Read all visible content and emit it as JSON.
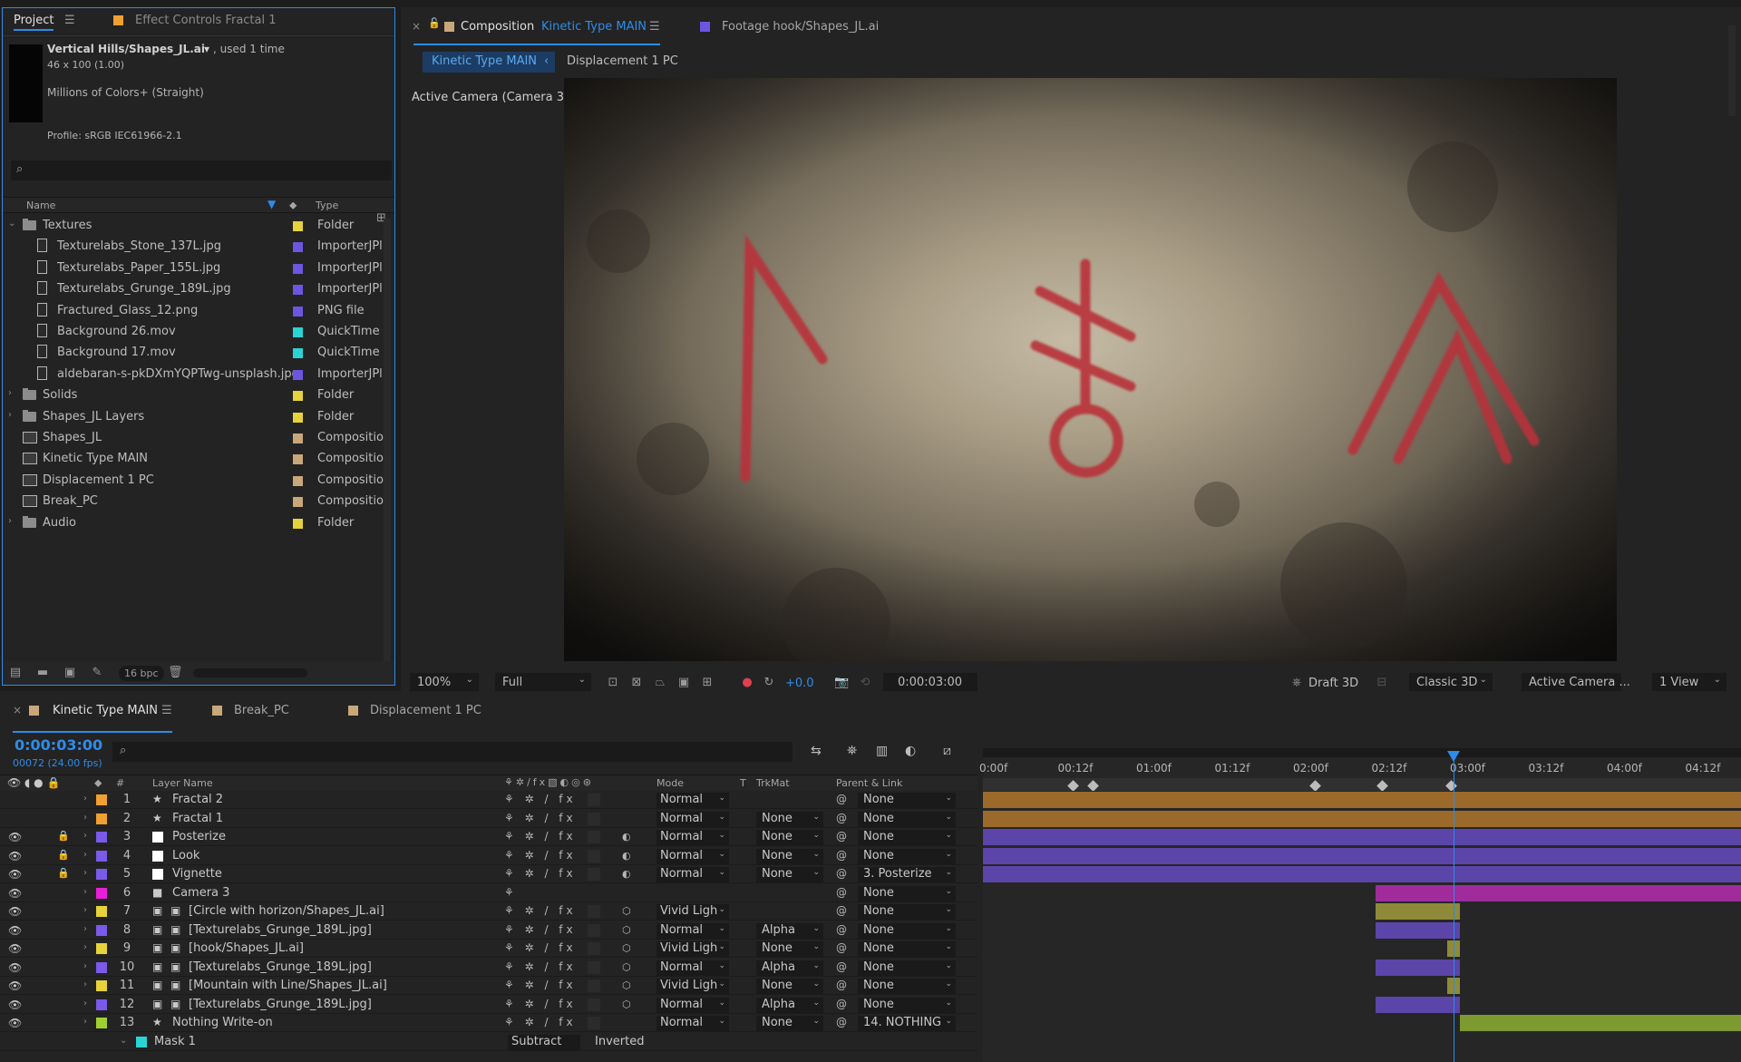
{
  "project_panel": {
    "tab_project": "Project",
    "tab_effect_controls": "Effect Controls Fractal 1",
    "selected_item": "Vertical Hills/Shapes_JL.ai",
    "used_count": ", used 1 time",
    "dimensions": "46 x 100 (1.00)",
    "colors": "Millions of Colors+ (Straight)",
    "profile": "Profile: sRGB IEC61966-2.1",
    "col_name": "Name",
    "col_type": "Type",
    "bpc": "16 bpc",
    "items": [
      {
        "name": "Textures",
        "type": "Folder",
        "color": "#e6d23a",
        "kind": "folder",
        "indent": 0,
        "twirl": "open"
      },
      {
        "name": "Texturelabs_Stone_137L.jpg",
        "type": "ImporterJPl",
        "color": "#6e55e0",
        "kind": "file",
        "indent": 1
      },
      {
        "name": "Texturelabs_Paper_155L.jpg",
        "type": "ImporterJPl",
        "color": "#6e55e0",
        "kind": "file",
        "indent": 1
      },
      {
        "name": "Texturelabs_Grunge_189L.jpg",
        "type": "ImporterJPl",
        "color": "#6e55e0",
        "kind": "file",
        "indent": 1
      },
      {
        "name": "Fractured_Glass_12.png",
        "type": "PNG file",
        "color": "#6e55e0",
        "kind": "file",
        "indent": 1
      },
      {
        "name": "Background 26.mov",
        "type": "QuickTime",
        "color": "#2ad4d4",
        "kind": "file",
        "indent": 1
      },
      {
        "name": "Background 17.mov",
        "type": "QuickTime",
        "color": "#2ad4d4",
        "kind": "file",
        "indent": 1
      },
      {
        "name": "aldebaran-s-pkDXmYQPTwg-unsplash.jpg",
        "type": "ImporterJPl",
        "color": "#6e55e0",
        "kind": "file",
        "indent": 1
      },
      {
        "name": "Solids",
        "type": "Folder",
        "color": "#e6d23a",
        "kind": "folder",
        "indent": 0,
        "twirl": "closed"
      },
      {
        "name": "Shapes_JL Layers",
        "type": "Folder",
        "color": "#e6d23a",
        "kind": "folder",
        "indent": 0,
        "twirl": "closed"
      },
      {
        "name": "Shapes_JL",
        "type": "Compositio",
        "color": "#c9a77a",
        "kind": "comp",
        "indent": 0
      },
      {
        "name": "Kinetic Type MAIN",
        "type": "Compositio",
        "color": "#c9a77a",
        "kind": "comp",
        "indent": 0
      },
      {
        "name": "Displacement 1 PC",
        "type": "Compositio",
        "color": "#c9a77a",
        "kind": "comp",
        "indent": 0
      },
      {
        "name": "Break_PC",
        "type": "Compositio",
        "color": "#c9a77a",
        "kind": "comp",
        "indent": 0
      },
      {
        "name": "Audio",
        "type": "Folder",
        "color": "#e6d23a",
        "kind": "folder",
        "indent": 0,
        "twirl": "closed"
      }
    ]
  },
  "viewer": {
    "tab_comp_prefix": "Composition",
    "tab_comp_name": "Kinetic Type MAIN",
    "tab_footage": "Footage hook/Shapes_JL.ai",
    "subtab_active": "Kinetic Type MAIN",
    "subtab_other": "Displacement 1 PC",
    "camera_label": "Active Camera (Camera 3)",
    "zoom": "100%",
    "resolution": "Full",
    "exposure": "+0.0",
    "timecode": "0:00:03:00",
    "draft3d": "Draft 3D",
    "renderer": "Classic 3D",
    "view": "Active Camera ...",
    "views": "1 View"
  },
  "timeline": {
    "tabs": [
      "Kinetic Type MAIN",
      "Break_PC",
      "Displacement 1 PC"
    ],
    "current_time": "0:00:03:00",
    "frame_info": "00072 (24.00 fps)",
    "col_layer_name": "Layer Name",
    "col_mode": "Mode",
    "col_t": "T",
    "col_trkmat": "TrkMat",
    "col_parent": "Parent & Link",
    "ruler_ticks": [
      "0:00f",
      "00:12f",
      "01:00f",
      "01:12f",
      "02:00f",
      "02:12f",
      "03:00f",
      "03:12f",
      "04:00f",
      "04:12f"
    ],
    "layers": [
      {
        "num": "1",
        "name": "Fractal 2",
        "type": "star",
        "color": "#f0a030",
        "mode": "Normal",
        "trkmat": "",
        "parent": "None",
        "eye": false,
        "lock": false,
        "bar": {
          "start": 0.0,
          "end": 5.0,
          "color": "#9b6a2a"
        }
      },
      {
        "num": "2",
        "name": "Fractal 1",
        "type": "star",
        "color": "#f0a030",
        "mode": "Normal",
        "trkmat": "None",
        "parent": "None",
        "eye": false,
        "lock": false,
        "bar": {
          "start": 0.0,
          "end": 5.0,
          "color": "#9b6a2a"
        }
      },
      {
        "num": "3",
        "name": "Posterize",
        "type": "solid",
        "color": "#7a5ae8",
        "mode": "Normal",
        "trkmat": "None",
        "parent": "None",
        "eye": true,
        "lock": true,
        "bar": {
          "start": 0.0,
          "end": 5.0,
          "color": "#5b45a8"
        }
      },
      {
        "num": "4",
        "name": "Look",
        "type": "solid",
        "color": "#7a5ae8",
        "mode": "Normal",
        "trkmat": "None",
        "parent": "None",
        "eye": true,
        "lock": true,
        "bar": {
          "start": 0.0,
          "end": 5.0,
          "color": "#5b45a8"
        }
      },
      {
        "num": "5",
        "name": "Vignette",
        "type": "solid",
        "color": "#7a5ae8",
        "mode": "Normal",
        "trkmat": "None",
        "parent": "3. Posterize",
        "eye": true,
        "lock": true,
        "bar": {
          "start": 0.0,
          "end": 5.0,
          "color": "#5b45a8"
        }
      },
      {
        "num": "6",
        "name": "Camera 3",
        "type": "camera",
        "color": "#e620d8",
        "mode": "",
        "trkmat": "",
        "parent": "None",
        "eye": true,
        "lock": false,
        "bar": {
          "start": 2.5,
          "end": 5.0,
          "color": "#a02c9c"
        }
      },
      {
        "num": "7",
        "name": "[Circle with horizon/Shapes_JL.ai]",
        "type": "ai",
        "color": "#e6d23a",
        "mode": "Vivid Ligh",
        "trkmat": "",
        "parent": "None",
        "eye": true,
        "lock": false,
        "bar": {
          "start": 2.5,
          "end": 3.04,
          "color": "#8f8a3a"
        }
      },
      {
        "num": "8",
        "name": "[Texturelabs_Grunge_189L.jpg]",
        "type": "jpg",
        "color": "#7a5ae8",
        "mode": "Normal",
        "trkmat": "Alpha",
        "parent": "None",
        "eye": true,
        "lock": false,
        "bar": {
          "start": 2.5,
          "end": 3.04,
          "color": "#5b45a8"
        }
      },
      {
        "num": "9",
        "name": "[hook/Shapes_JL.ai]",
        "type": "ai",
        "color": "#e6d23a",
        "mode": "Vivid Ligh",
        "trkmat": "None",
        "parent": "None",
        "eye": true,
        "lock": false,
        "bar": {
          "start": 2.96,
          "end": 3.04,
          "color": "#8f8a3a"
        }
      },
      {
        "num": "10",
        "name": "[Texturelabs_Grunge_189L.jpg]",
        "type": "jpg",
        "color": "#7a5ae8",
        "mode": "Normal",
        "trkmat": "Alpha",
        "parent": "None",
        "eye": true,
        "lock": false,
        "bar": {
          "start": 2.5,
          "end": 3.04,
          "color": "#5b45a8"
        }
      },
      {
        "num": "11",
        "name": "[Mountain with Line/Shapes_JL.ai]",
        "type": "ai",
        "color": "#e6d23a",
        "mode": "Vivid Ligh",
        "trkmat": "None",
        "parent": "None",
        "eye": true,
        "lock": false,
        "bar": {
          "start": 2.96,
          "end": 3.04,
          "color": "#8f8a3a"
        }
      },
      {
        "num": "12",
        "name": "[Texturelabs_Grunge_189L.jpg]",
        "type": "jpg",
        "color": "#7a5ae8",
        "mode": "Normal",
        "trkmat": "Alpha",
        "parent": "None",
        "eye": true,
        "lock": false,
        "bar": {
          "start": 2.5,
          "end": 3.04,
          "color": "#5b45a8"
        }
      },
      {
        "num": "13",
        "name": "Nothing Write-on",
        "type": "star",
        "color": "#a0d030",
        "mode": "Normal",
        "trkmat": "None",
        "parent": "14. NOTHING",
        "eye": true,
        "lock": false,
        "bar": {
          "start": 3.04,
          "end": 5.0,
          "color": "#7d9a30"
        }
      }
    ],
    "mask": {
      "name": "Mask 1",
      "mode": "Subtract",
      "inverted": "Inverted",
      "color": "#2ad4d4"
    }
  }
}
